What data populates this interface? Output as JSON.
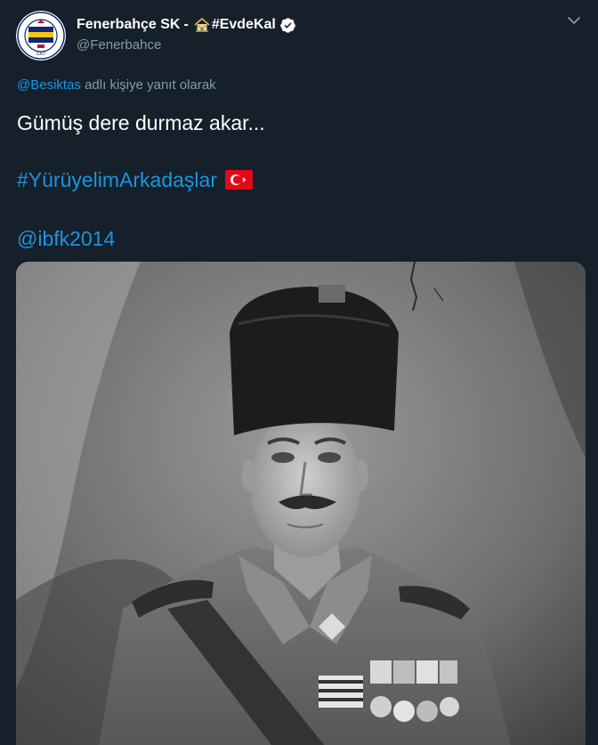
{
  "tweet": {
    "author": {
      "display_name": "Fenerbahçe SK",
      "separator": "-",
      "campaign_tag": "#EvdeKal",
      "handle": "@Fenerbahce",
      "verified": true,
      "avatar_icon": "fenerbahce-crest-icon",
      "avatar_year": "1907"
    },
    "reply_to": {
      "mention": "@Besiktas",
      "suffix": "adlı kişiye yanıt olarak"
    },
    "body": {
      "line1": "Gümüş dere durmaz akar...",
      "hashtag": "#YürüyelimArkadaşlar",
      "flag_icon": "turkey-flag-icon",
      "mention": "@ibfk2014"
    },
    "media": {
      "type": "photo",
      "description_icon": "portrait-photo"
    },
    "menu_icon": "chevron-down-icon"
  },
  "colors": {
    "background": "#15202b",
    "text": "#ffffff",
    "secondary": "#8899a6",
    "link": "#1b95e0",
    "verified": "#ffffff",
    "crest_yellow": "#f6c90e",
    "crest_navy": "#102a6b"
  }
}
